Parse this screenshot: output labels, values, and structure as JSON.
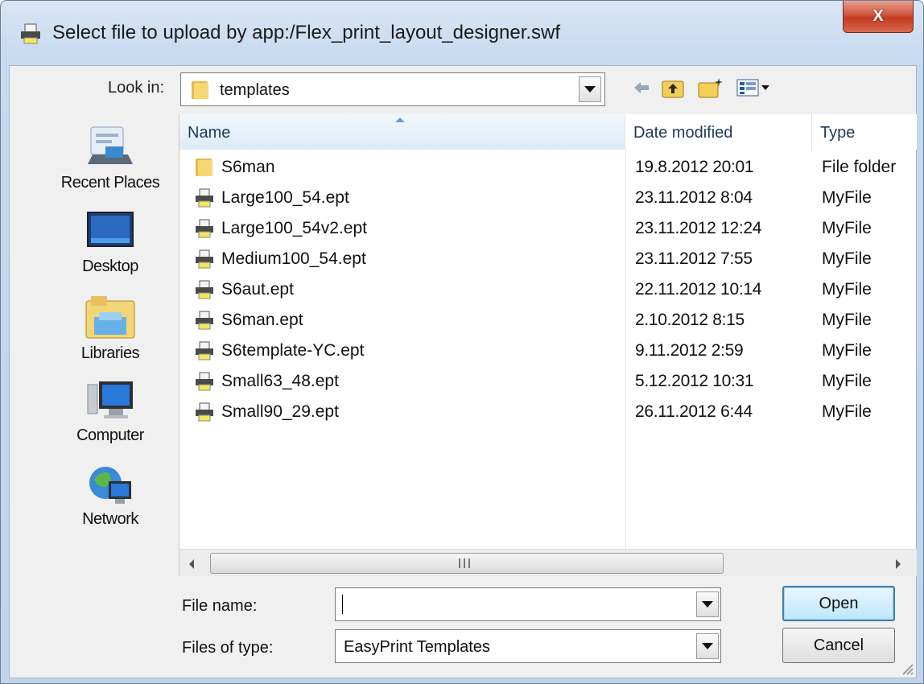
{
  "window": {
    "title": "Select file to upload by app:/Flex_print_layout_designer.swf",
    "close_label": "X"
  },
  "lookin": {
    "label": "Look in:",
    "value": "templates"
  },
  "places": [
    {
      "label": "Recent Places",
      "icon": "recent-places-icon"
    },
    {
      "label": "Desktop",
      "icon": "desktop-icon"
    },
    {
      "label": "Libraries",
      "icon": "libraries-icon"
    },
    {
      "label": "Computer",
      "icon": "computer-icon"
    },
    {
      "label": "Network",
      "icon": "network-icon"
    }
  ],
  "columns": {
    "name": "Name",
    "date": "Date modified",
    "type": "Type"
  },
  "files": [
    {
      "name": "S6man",
      "date": "19.8.2012 20:01",
      "type": "File folder",
      "icon": "folder-icon"
    },
    {
      "name": "Large100_54.ept",
      "date": "23.11.2012 8:04",
      "type": "MyFile",
      "icon": "printer-file-icon"
    },
    {
      "name": "Large100_54v2.ept",
      "date": "23.11.2012 12:24",
      "type": "MyFile",
      "icon": "printer-file-icon"
    },
    {
      "name": "Medium100_54.ept",
      "date": "23.11.2012 7:55",
      "type": "MyFile",
      "icon": "printer-file-icon"
    },
    {
      "name": "S6aut.ept",
      "date": "22.11.2012 10:14",
      "type": "MyFile",
      "icon": "printer-file-icon"
    },
    {
      "name": "S6man.ept",
      "date": "2.10.2012 8:15",
      "type": "MyFile",
      "icon": "printer-file-icon"
    },
    {
      "name": "S6template-YC.ept",
      "date": "9.11.2012 2:59",
      "type": "MyFile",
      "icon": "printer-file-icon"
    },
    {
      "name": "Small63_48.ept",
      "date": "5.12.2012 10:31",
      "type": "MyFile",
      "icon": "printer-file-icon"
    },
    {
      "name": "Small90_29.ept",
      "date": "26.11.2012 6:44",
      "type": "MyFile",
      "icon": "printer-file-icon"
    }
  ],
  "bottom": {
    "filename_label": "File name:",
    "filename_value": "",
    "filetype_label": "Files of type:",
    "filetype_value": "EasyPrint Templates",
    "open_label": "Open",
    "cancel_label": "Cancel"
  },
  "colors": {
    "accent": "#3c7fb1",
    "close_red": "#c23a22",
    "header_text": "#1e395b"
  }
}
